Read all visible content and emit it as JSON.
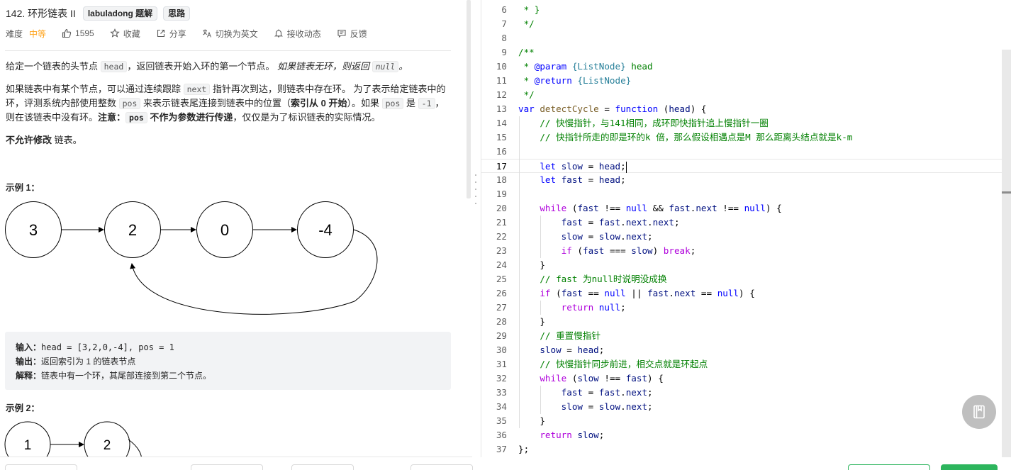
{
  "problem": {
    "title": "142. 环形链表 II",
    "tags": [
      "labuladong 题解",
      "思路"
    ],
    "meta": {
      "difficulty_label": "难度",
      "difficulty": "中等",
      "likes": "1595",
      "favorite": "收藏",
      "share": "分享",
      "switch_lang": "切换为英文",
      "notify": "接收动态",
      "feedback": "反馈"
    },
    "desc1": {
      "a": "给定一个链表的头节点 ",
      "code1": "head",
      "b": "，返回链表开始入环的第一个节点。 ",
      "c": "如果链表无环，则返回 ",
      "code2": "null",
      "d": "。"
    },
    "desc2": {
      "a": "如果链表中有某个节点，可以通过连续跟踪 ",
      "code1": "next",
      "b": " 指针再次到达，则链表中存在环。 为了表示给定链表中的环，评测系统内部使用整数 ",
      "code2": "pos",
      "c": " 来表示链表尾连接到链表中的位置（",
      "d": "索引从 0 开始",
      "e": "）。如果 ",
      "code3": "pos",
      "f": " 是 ",
      "code4": "-1",
      "g": "，则在该链表中没有环。",
      "h": "注意：",
      "code5": "pos",
      "i": " 不作为参数进行传递",
      "j": "，仅仅是为了标识链表的实际情况。"
    },
    "desc3": {
      "bold": "不允许修改",
      "rest": " 链表。"
    },
    "example1": {
      "heading": "示例 1：",
      "nodes": [
        "3",
        "2",
        "0",
        "-4"
      ],
      "input_label": "输入：",
      "input": "head = [3,2,0,-4], pos = 1",
      "output_label": "输出：",
      "output": "返回索引为 1 的链表节点",
      "explain_label": "解释：",
      "explain": "链表中有一个环，其尾部连接到第二个节点。"
    },
    "example2": {
      "heading": "示例 2：",
      "nodes": [
        "1",
        "2"
      ]
    }
  },
  "editor": {
    "lines": [
      {
        "n": "6",
        "t": " * }"
      },
      {
        "n": "7",
        "t": " */"
      },
      {
        "n": "8",
        "t": ""
      },
      {
        "n": "9",
        "t": "/**"
      },
      {
        "n": "10",
        "t": " * @param {ListNode} head"
      },
      {
        "n": "11",
        "t": " * @return {ListNode}"
      },
      {
        "n": "12",
        "t": " */"
      },
      {
        "n": "13",
        "t": "var detectCycle = function (head) {"
      },
      {
        "n": "14",
        "t": "    // 快慢指针，与141相同，成环即快指针追上慢指针一圈"
      },
      {
        "n": "15",
        "t": "    // 快指针所走的即是环的k 倍，那么假设相遇点是M 那么距离头结点就是k-m"
      },
      {
        "n": "16",
        "t": ""
      },
      {
        "n": "17",
        "t": "    let slow = head;"
      },
      {
        "n": "18",
        "t": "    let fast = head;"
      },
      {
        "n": "19",
        "t": ""
      },
      {
        "n": "20",
        "t": "    while (fast !== null && fast.next !== null) {"
      },
      {
        "n": "21",
        "t": "        fast = fast.next.next;"
      },
      {
        "n": "22",
        "t": "        slow = slow.next;"
      },
      {
        "n": "23",
        "t": "        if (fast === slow) break;"
      },
      {
        "n": "24",
        "t": "    }"
      },
      {
        "n": "25",
        "t": "    // fast 为null时说明没成换"
      },
      {
        "n": "26",
        "t": "    if (fast == null || fast.next == null) {"
      },
      {
        "n": "27",
        "t": "        return null;"
      },
      {
        "n": "28",
        "t": "    }"
      },
      {
        "n": "29",
        "t": "    // 重置慢指针"
      },
      {
        "n": "30",
        "t": "    slow = head;"
      },
      {
        "n": "31",
        "t": "    // 快慢指针同步前进，相交点就是环起点"
      },
      {
        "n": "32",
        "t": "    while (slow !== fast) {"
      },
      {
        "n": "33",
        "t": "        fast = fast.next;"
      },
      {
        "n": "34",
        "t": "        slow = slow.next;"
      },
      {
        "n": "35",
        "t": "    }"
      },
      {
        "n": "36",
        "t": "    return slow;"
      },
      {
        "n": "37",
        "t": "};"
      }
    ],
    "active_line": "17",
    "colors": {
      "comment": "#008000",
      "keyword": "#0000ff",
      "control": "#af00db",
      "jsdoc_tag": "#0000ff",
      "jsdoc_type": "#267f99",
      "function_name": "#795e26",
      "variable": "#001080"
    }
  },
  "icons": {
    "like": "thumbs-up-icon",
    "favorite": "star-icon",
    "share": "share-icon",
    "translate": "translate-icon",
    "notify": "bell-icon",
    "feedback": "feedback-icon",
    "floating": "notebook-icon"
  }
}
